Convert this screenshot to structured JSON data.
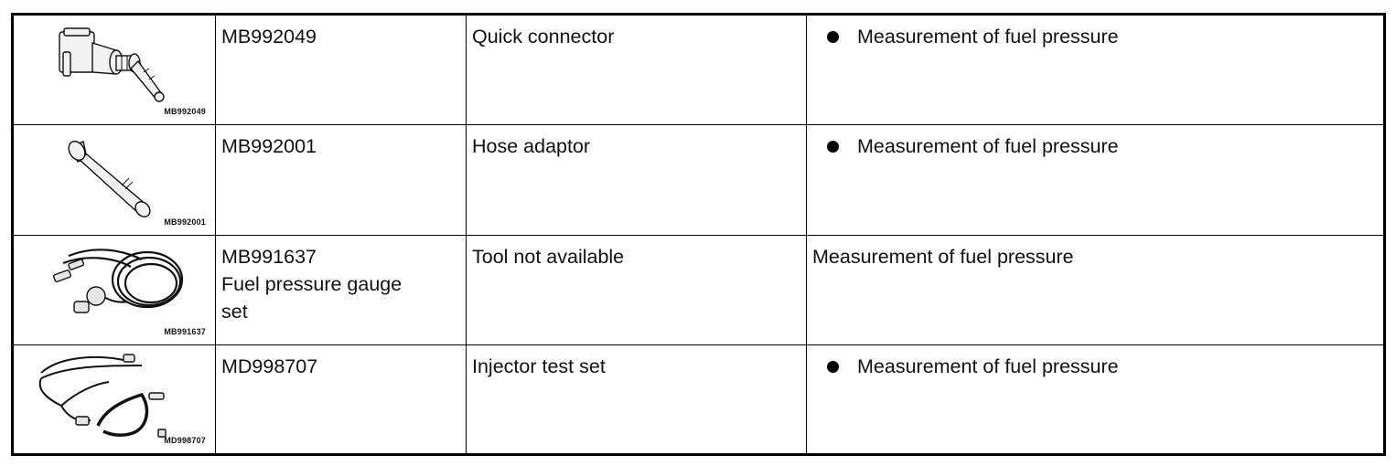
{
  "rows": [
    {
      "image_label": "MB992049",
      "part_no": "MB992049",
      "part_no_extra": [],
      "name": "Quick connector",
      "application": "Measurement of fuel pressure",
      "bulleted": true
    },
    {
      "image_label": "MB992001",
      "part_no": "MB992001",
      "part_no_extra": [],
      "name": "Hose adaptor",
      "application": "Measurement of fuel pressure",
      "bulleted": true
    },
    {
      "image_label": "MB991637",
      "part_no": "MB991637",
      "part_no_extra": [
        "Fuel pressure gauge",
        "set"
      ],
      "name": "Tool not available",
      "application": "Measurement of fuel pressure",
      "bulleted": false
    },
    {
      "image_label": "MD998707",
      "part_no": "MD998707",
      "part_no_extra": [],
      "name": "Injector test set",
      "application": "Measurement of fuel pressure",
      "bulleted": true
    }
  ]
}
